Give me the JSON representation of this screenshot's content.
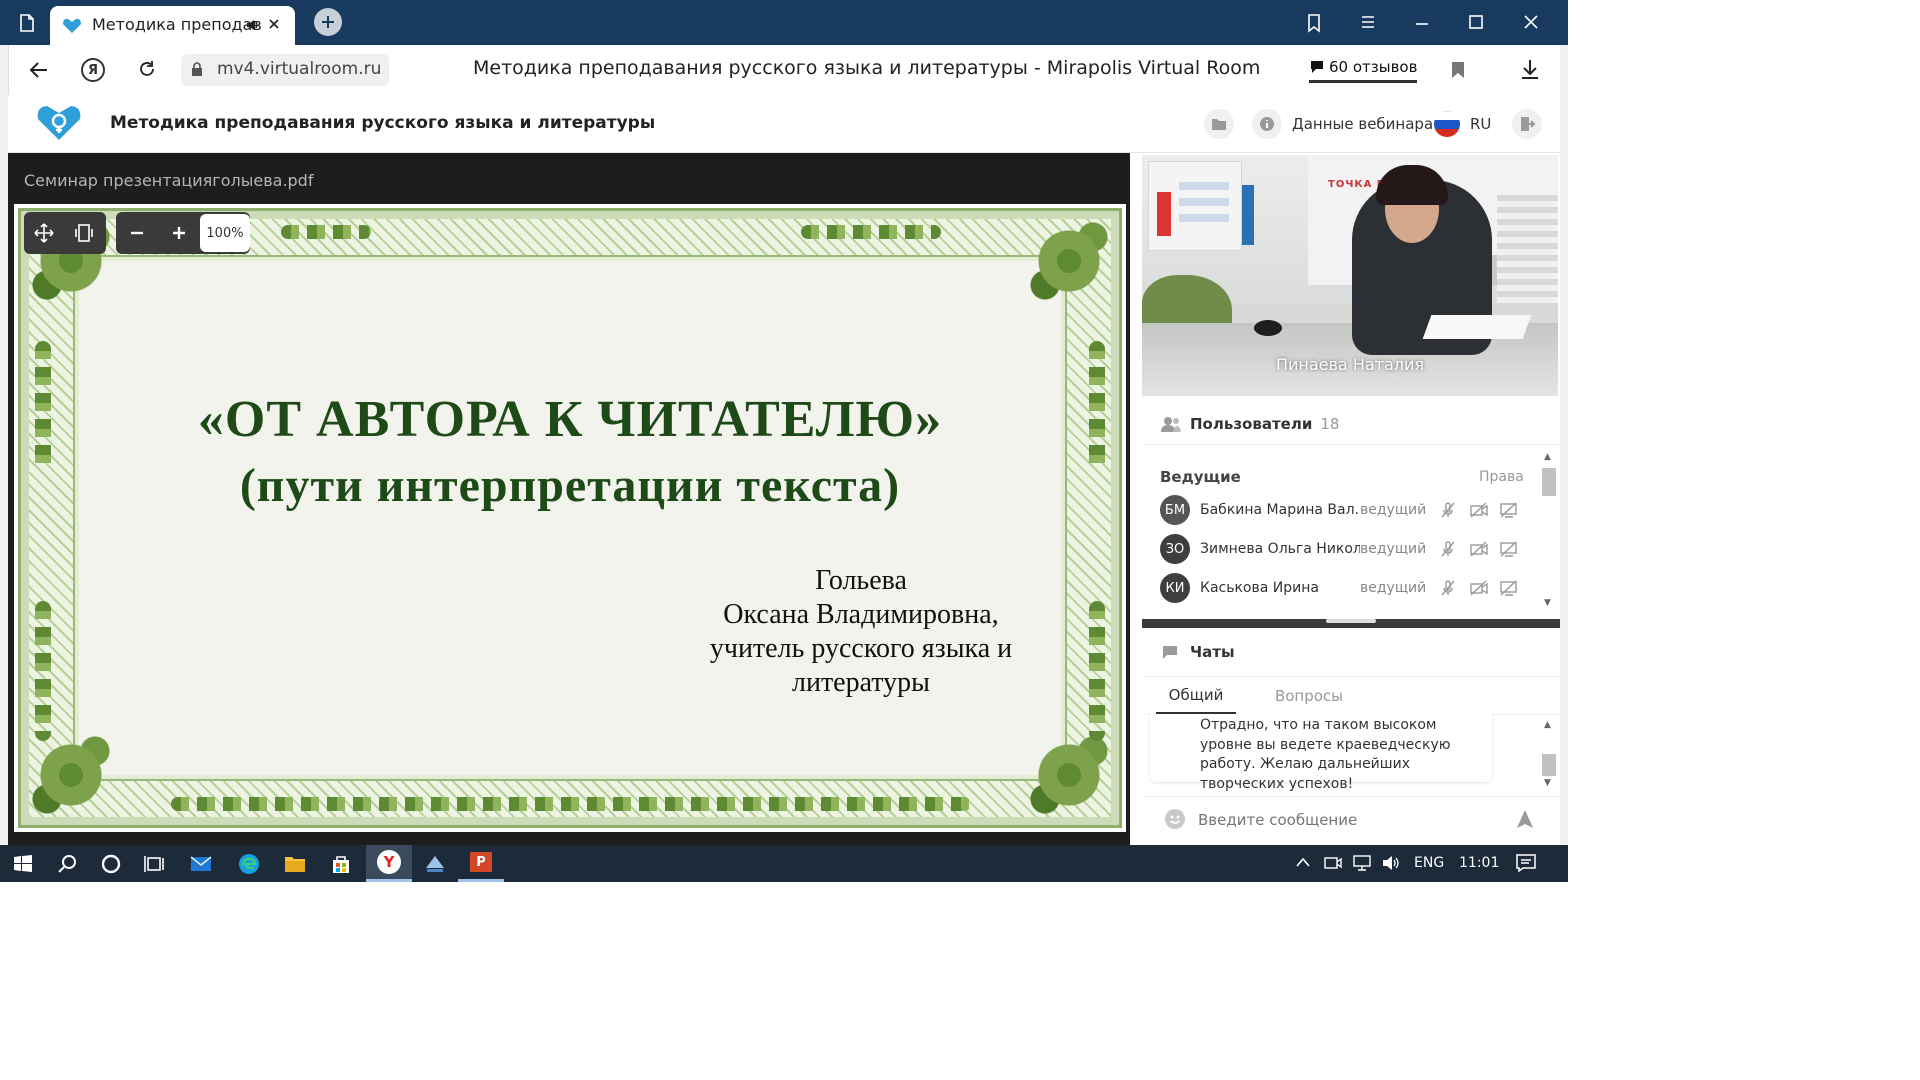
{
  "browser": {
    "tab_title": "Методика преподав",
    "address": "mv4.virtualroom.ru",
    "page_title": "Методика преподавания русского языка и литературы - Mirapolis Virtual Room",
    "reviews": "60 отзывов"
  },
  "app": {
    "title": "Методика преподавания русского языка и литературы",
    "webinar_data_label": "Данные вебинара",
    "language": "RU"
  },
  "presentation": {
    "filename": "Семинар презентацияголыева.pdf",
    "zoom": "100%",
    "slide": {
      "title_line1": "«ОТ АВТОРА К ЧИТАТЕЛЮ»",
      "title_line2": "(пути интерпретации текста)",
      "author_lines": [
        "Гольева",
        "Оксана Владимировна,",
        "учитель русского языка и",
        "литературы"
      ]
    }
  },
  "video": {
    "speaker_name": "Пинаева Наталия",
    "bg_sign": "ТОЧКА РОСТА"
  },
  "users_panel": {
    "title": "Пользователи",
    "count": "18",
    "section": "Ведущие",
    "rights_label": "Права",
    "rows": [
      {
        "initials": "БМ",
        "name": "Бабкина Марина Вал...",
        "role": "ведущий"
      },
      {
        "initials": "ЗО",
        "name": "Зимнева Ольга Никол...",
        "role": "ведущий"
      },
      {
        "initials": "КИ",
        "name": "Каськова Ирина",
        "role": "ведущий"
      }
    ]
  },
  "chats_panel": {
    "title": "Чаты",
    "tabs": [
      "Общий",
      "Вопросы"
    ],
    "message": "Отрадно, что на таком высоком уровне вы ведете краеведческую работу. Желаю дальнейших творческих успехов!",
    "input_placeholder": "Введите сообщение"
  },
  "taskbar": {
    "language": "ENG",
    "time": "11:01"
  },
  "colors": {
    "tabbar": "#173a5e",
    "slide_title": "#1e4a17",
    "taskbar": "#1c2a3a",
    "accent_tab": "#333333"
  }
}
